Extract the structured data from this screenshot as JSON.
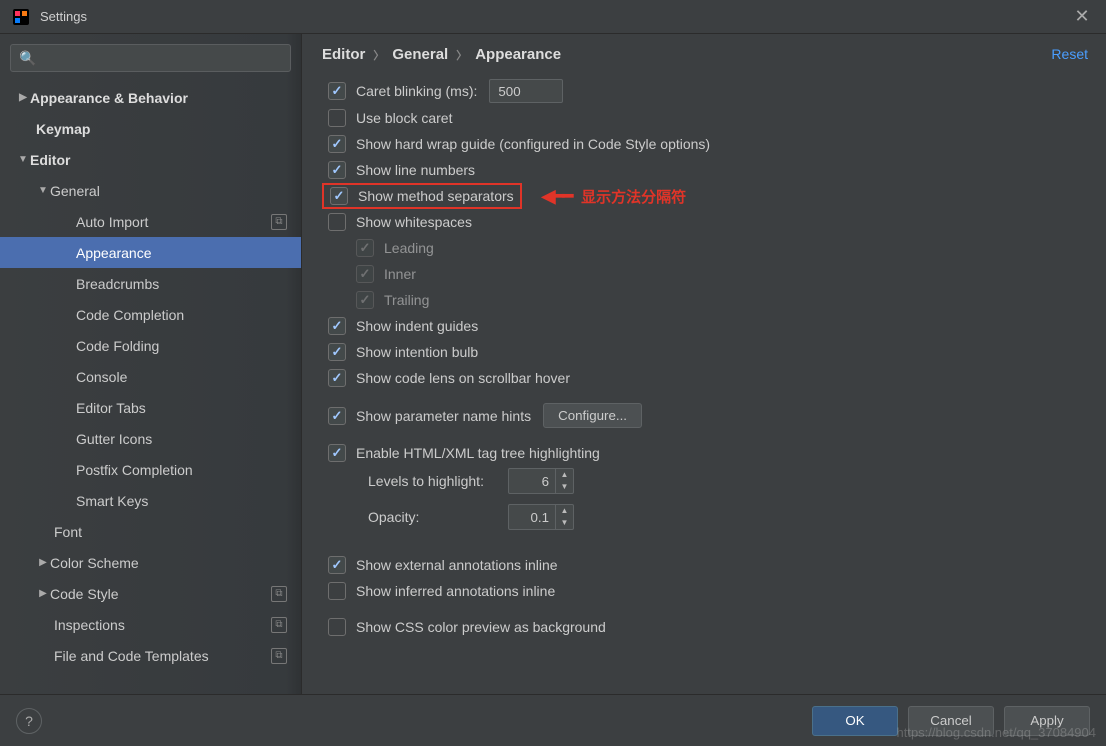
{
  "window": {
    "title": "Settings"
  },
  "search": {
    "placeholder": ""
  },
  "sidebar": {
    "appearance_behavior": "Appearance & Behavior",
    "keymap": "Keymap",
    "editor": "Editor",
    "general": "General",
    "items": {
      "auto_import": "Auto Import",
      "appearance": "Appearance",
      "breadcrumbs": "Breadcrumbs",
      "code_completion": "Code Completion",
      "code_folding": "Code Folding",
      "console": "Console",
      "editor_tabs": "Editor Tabs",
      "gutter_icons": "Gutter Icons",
      "postfix_completion": "Postfix Completion",
      "smart_keys": "Smart Keys"
    },
    "font": "Font",
    "color_scheme": "Color Scheme",
    "code_style": "Code Style",
    "inspections": "Inspections",
    "file_templates": "File and Code Templates"
  },
  "breadcrumb": {
    "a": "Editor",
    "b": "General",
    "c": "Appearance"
  },
  "reset": "Reset",
  "opts": {
    "caret_blinking": "Caret blinking (ms):",
    "caret_value": "500",
    "use_block_caret": "Use block caret",
    "hard_wrap": "Show hard wrap guide (configured in Code Style options)",
    "line_numbers": "Show line numbers",
    "method_sep": "Show method separators",
    "whitespaces": "Show whitespaces",
    "leading": "Leading",
    "inner": "Inner",
    "trailing": "Trailing",
    "indent_guides": "Show indent guides",
    "intention_bulb": "Show intention bulb",
    "code_lens": "Show code lens on scrollbar hover",
    "param_hints": "Show parameter name hints",
    "configure": "Configure...",
    "html_tag": "Enable HTML/XML tag tree highlighting",
    "levels_label": "Levels to highlight:",
    "levels_value": "6",
    "opacity_label": "Opacity:",
    "opacity_value": "0.1",
    "ext_annot": "Show external annotations inline",
    "inf_annot": "Show inferred annotations inline",
    "css_preview": "Show CSS color preview as background"
  },
  "annotation": {
    "arrow": "⟵",
    "text": "显示方法分隔符"
  },
  "footer": {
    "help": "?",
    "ok": "OK",
    "cancel": "Cancel",
    "apply": "Apply"
  },
  "watermark": "https://blog.csdn.net/qq_37084904"
}
